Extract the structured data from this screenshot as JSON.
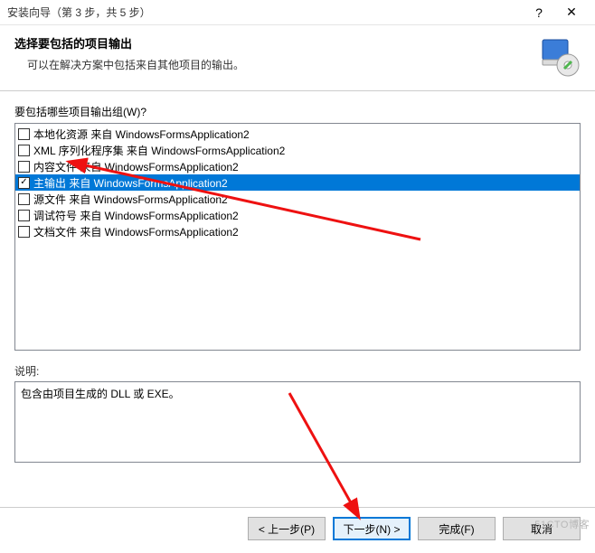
{
  "titlebar": {
    "title": "安装向导（第 3 步，共 5 步）",
    "help": "?",
    "close": "✕"
  },
  "header": {
    "title": "选择要包括的项目输出",
    "subtitle": "可以在解决方案中包括来自其他项目的输出。"
  },
  "group_label": "要包括哪些项目输出组(W)?",
  "items": [
    {
      "checked": false,
      "label": "本地化资源 来自 WindowsFormsApplication2"
    },
    {
      "checked": false,
      "label": "XML 序列化程序集 来自 WindowsFormsApplication2"
    },
    {
      "checked": false,
      "label": "内容文件 来自 WindowsFormsApplication2"
    },
    {
      "checked": true,
      "label": "主输出 来自 WindowsFormsApplication2",
      "selected": true
    },
    {
      "checked": false,
      "label": "源文件 来自 WindowsFormsApplication2"
    },
    {
      "checked": false,
      "label": "调试符号 来自 WindowsFormsApplication2"
    },
    {
      "checked": false,
      "label": "文档文件 来自 WindowsFormsApplication2"
    }
  ],
  "desc_label": "说明:",
  "description": "包含由项目生成的 DLL 或 EXE。",
  "buttons": {
    "back": "< 上一步(P)",
    "next": "下一步(N) >",
    "finish": "完成(F)",
    "cancel": "取消"
  },
  "watermark": "51CTO博客"
}
